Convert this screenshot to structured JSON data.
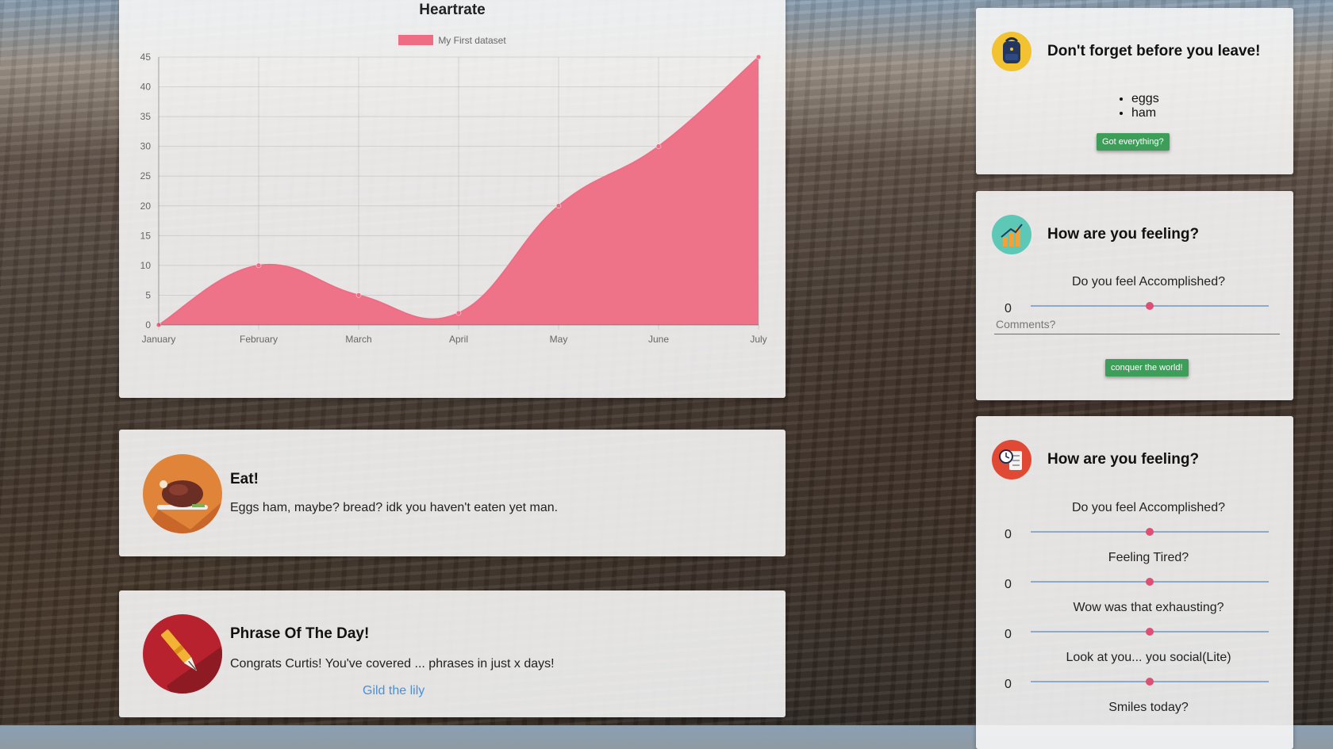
{
  "chart_card": {
    "title": "Heartrate",
    "legend_label": "My First dataset",
    "series_color": "#ee6d84"
  },
  "chart_data": {
    "type": "area",
    "title": "Heartrate",
    "categories": [
      "January",
      "February",
      "March",
      "April",
      "May",
      "June",
      "July"
    ],
    "series": [
      {
        "name": "My First dataset",
        "values": [
          0,
          10,
          5,
          2,
          20,
          30,
          45
        ]
      }
    ],
    "y_ticks": [
      0,
      5,
      10,
      15,
      20,
      25,
      30,
      35,
      40,
      45
    ],
    "ylim": [
      0,
      45
    ],
    "grid": true,
    "legend_position": "top"
  },
  "eat_card": {
    "icon": "roast-chicken-icon",
    "title": "Eat!",
    "text": "Eggs ham, maybe? bread? idk you haven't eaten yet man."
  },
  "phrase_card": {
    "icon": "fountain-pen-icon",
    "title": "Phrase Of The Day!",
    "text": "Congrats Curtis! You've covered ... phrases in just x days!",
    "link": "Gild the lily"
  },
  "leave_card": {
    "icon": "backpack-icon",
    "title": "Don't forget before you leave!",
    "items": [
      "eggs",
      "ham"
    ],
    "button": "Got everything?"
  },
  "feel_card_1": {
    "icon": "bar-chart-icon",
    "title": "How are you feeling?",
    "question": "Do you feel Accomplished?",
    "value": "0",
    "slider_level": 0.5,
    "comments_placeholder": "Comments?",
    "button": "conquer the world!"
  },
  "feel_card_2": {
    "icon": "clock-checklist-icon",
    "title": "How are you feeling?",
    "questions": [
      {
        "label": "Do you feel Accomplished?",
        "value": "0",
        "level": 0.5
      },
      {
        "label": "Feeling Tired?",
        "value": "0",
        "level": 0.5
      },
      {
        "label": "Wow was that exhausting?",
        "value": "0",
        "level": 0.5
      },
      {
        "label": "Look at you... you social(Lite)",
        "value": "0",
        "level": 0.5
      },
      {
        "label": "Smiles today?"
      }
    ]
  },
  "colors": {
    "button_green": "#3c9e58",
    "slider_thumb": "#dd4f73",
    "slider_track": "#8fa9c8",
    "link_blue": "#4a8fd8"
  }
}
